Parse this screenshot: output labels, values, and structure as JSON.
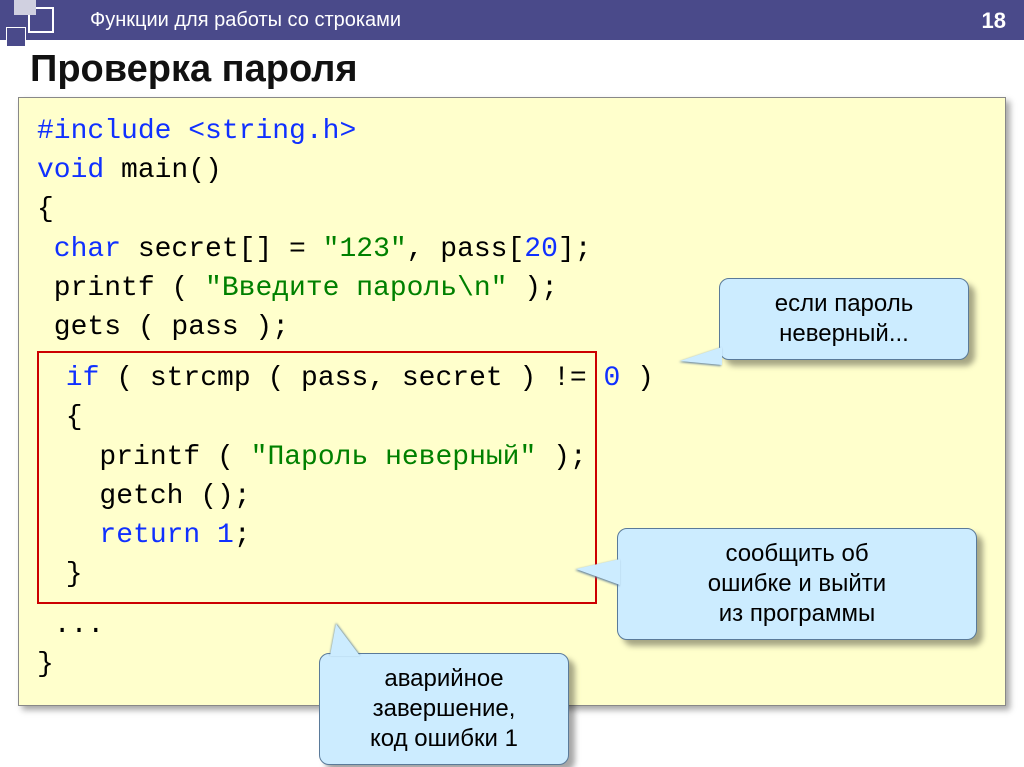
{
  "header": {
    "breadcrumb": "Функции для работы со строками",
    "page_number": "18"
  },
  "title": "Проверка пароля",
  "code": {
    "l1_kw": "#include ",
    "l1_hdr": "<string.h>",
    "l2_kw": "void",
    "l2_rest": " main()",
    "l3": "{",
    "l4_kw": " char",
    "l4_a": " secret[] = ",
    "l4_str": "\"123\"",
    "l4_b": ", pass[",
    "l4_num": "20",
    "l4_c": "];",
    "l5_a": " printf ( ",
    "l5_str": "\"Введите пароль\\n\"",
    "l5_b": " );",
    "l6": " gets ( pass );",
    "b1_kw": " if",
    "b1_rest": " ( strcmp ( pass, secret ) != ",
    "b1_zero": "0",
    "b1_end": " )",
    "b2": " {",
    "b3_a": "   printf ( ",
    "b3_str": "\"Пароль неверный\"",
    "b3_b": " );",
    "b4": "   getch ();",
    "b5_kw": "   return",
    "b5_rest": " ",
    "b5_num": "1",
    "b5_end": ";",
    "b6": " }",
    "l_after1": " ...",
    "l_after2": "}"
  },
  "callouts": {
    "c1_line1": "если пароль",
    "c1_line2": "неверный...",
    "c2_line1": "сообщить об",
    "c2_line2": "ошибке и выйти",
    "c2_line3": "из программы",
    "c3_line1": "аварийное",
    "c3_line2": "завершение,",
    "c3_line3": "код ошибки 1"
  }
}
